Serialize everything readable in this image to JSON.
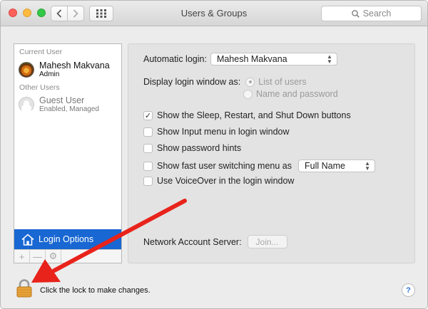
{
  "window": {
    "title": "Users & Groups",
    "search_placeholder": "Search"
  },
  "sidebar": {
    "current_user_label": "Current User",
    "current_user": {
      "name": "Mahesh Makvana",
      "role": "Admin"
    },
    "other_users_label": "Other Users",
    "other_users": [
      {
        "name": "Guest User",
        "status": "Enabled, Managed"
      }
    ],
    "login_options_label": "Login Options",
    "toolbar": {
      "add": "+",
      "remove": "—",
      "settings": "⚙"
    }
  },
  "login_options": {
    "automatic_login_label": "Automatic login:",
    "automatic_login_value": "Mahesh Makvana",
    "display_window_label": "Display login window as:",
    "display_options": [
      {
        "label": "List of users",
        "selected": true
      },
      {
        "label": "Name and password",
        "selected": false
      }
    ],
    "checkboxes": [
      {
        "label": "Show the Sleep, Restart, and Shut Down buttons",
        "checked": true
      },
      {
        "label": "Show Input menu in login window",
        "checked": false
      },
      {
        "label": "Show password hints",
        "checked": false
      },
      {
        "label": "Show fast user switching menu as",
        "checked": false
      },
      {
        "label": "Use VoiceOver in the login window",
        "checked": false
      }
    ],
    "fast_user_switching_value": "Full Name",
    "network_server_label": "Network Account Server:",
    "join_button": "Join..."
  },
  "footer": {
    "lock_text": "Click the lock to make changes.",
    "help": "?"
  },
  "colors": {
    "selection": "#1867d2",
    "annotation_arrow": "#e8231b"
  }
}
